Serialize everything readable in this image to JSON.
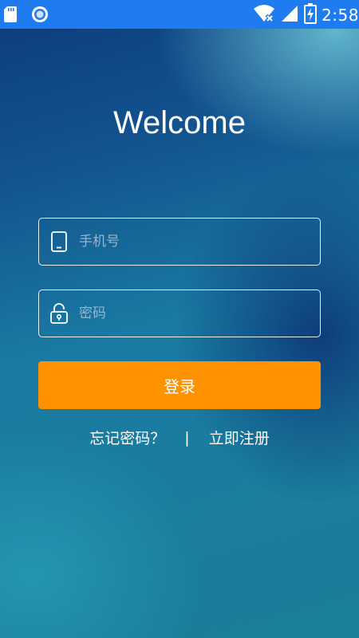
{
  "status_bar": {
    "time": "2:58",
    "icons": [
      "sd-card-icon",
      "sync-circle-icon",
      "wifi-off-icon",
      "signal-icon",
      "battery-charging-icon"
    ]
  },
  "login": {
    "title": "Welcome",
    "phone_placeholder": "手机号",
    "phone_icon": "phone-icon",
    "password_placeholder": "密码",
    "password_icon": "unlock-icon",
    "login_label": "登录",
    "forgot_label": "忘记密码？",
    "separator": "|",
    "register_label": "立即注册"
  },
  "colors": {
    "status_bar": "#1f7cf0",
    "button": "#ff9200",
    "text": "#ffffff"
  }
}
